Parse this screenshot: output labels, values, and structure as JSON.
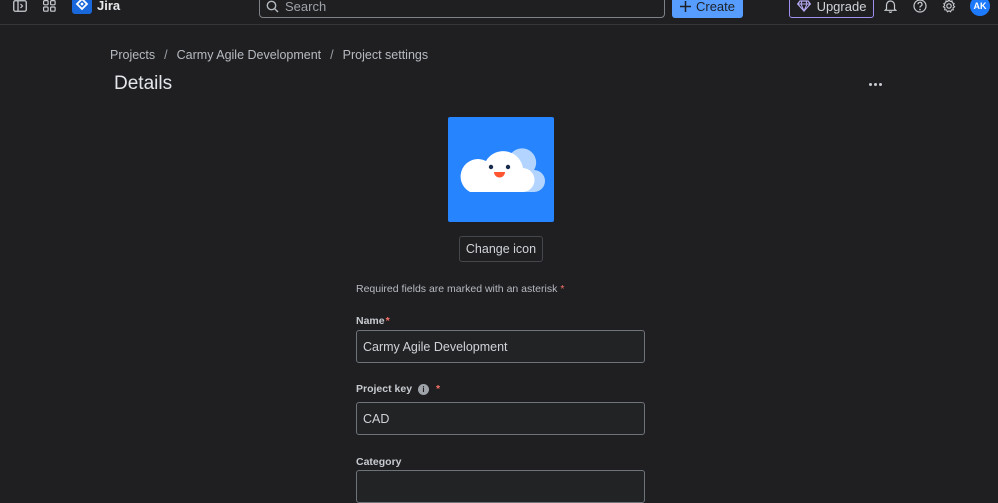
{
  "topbar": {
    "brand": "Jira",
    "search_placeholder": "Search",
    "create_label": "Create",
    "upgrade_label": "Upgrade",
    "avatar_initials": "AK"
  },
  "breadcrumb": {
    "items": [
      "Projects",
      "Carmy Agile Development",
      "Project settings"
    ],
    "separator": "/"
  },
  "page": {
    "title": "Details"
  },
  "form": {
    "change_icon_label": "Change icon",
    "required_note": "Required fields are marked with an asterisk",
    "asterisk": "*",
    "name_label": "Name",
    "name_value": "Carmy Agile Development",
    "project_key_label": "Project key",
    "project_key_value": "CAD",
    "category_label": "Category"
  },
  "colors": {
    "accent": "#579dff",
    "project_icon_bg": "#2684ff",
    "upgrade_border": "#9f8fef",
    "required": "#f87168"
  },
  "icons": [
    "sidebar-toggle-icon",
    "app-switcher-icon",
    "jira-logo-icon",
    "search-icon",
    "plus-icon",
    "gem-icon",
    "bell-icon",
    "help-icon",
    "gear-icon",
    "more-icon",
    "info-icon",
    "cloud-icon"
  ]
}
